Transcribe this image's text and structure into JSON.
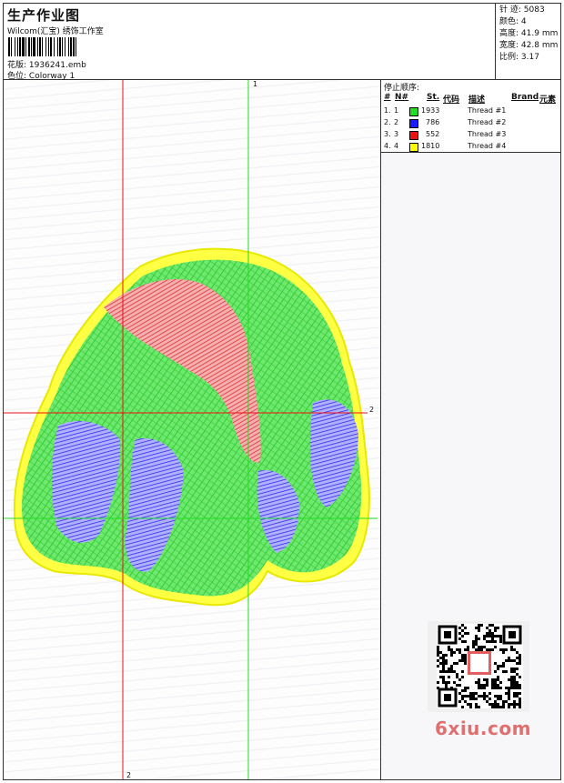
{
  "header": {
    "title": "生产作业图",
    "company": "Wilcom(汇宝) 绣饰工作室",
    "design_label": "花版:",
    "design_value": "1936241.emb",
    "colorway_label": "色位:",
    "colorway_value": "Colorway 1"
  },
  "specs": [
    {
      "label": "针 迹:",
      "value": "5083"
    },
    {
      "label": "颜色:",
      "value": "4"
    },
    {
      "label": "高度:",
      "value": "41.9 mm"
    },
    {
      "label": "宽度:",
      "value": "42.8 mm"
    },
    {
      "label": "比例:",
      "value": "3.17"
    }
  ],
  "stop_sequence": {
    "title": "停止顺序:",
    "columns": {
      "hash": "#",
      "n": "N#",
      "st": "St.",
      "code": "代码",
      "desc": "描述",
      "brand": "Brand",
      "element": "元素"
    },
    "rows": [
      {
        "idx": "1.",
        "n": "1",
        "color": "#22dd22",
        "st": "1933",
        "desc": "Thread #1"
      },
      {
        "idx": "2.",
        "n": "2",
        "color": "#1a1aff",
        "st": "786",
        "desc": "Thread #2"
      },
      {
        "idx": "3.",
        "n": "3",
        "color": "#ee1111",
        "st": "552",
        "desc": "Thread #3"
      },
      {
        "idx": "4.",
        "n": "4",
        "color": "#ffff00",
        "st": "1810",
        "desc": "Thread #4"
      }
    ]
  },
  "axes": {
    "top_label": "1",
    "right_label": "2",
    "bottom_label": "2"
  },
  "watermark": "6xiu.com",
  "colors": {
    "green": "#22dd22",
    "blue": "#1a1aff",
    "red": "#ee1111",
    "yellow": "#ffff00"
  }
}
